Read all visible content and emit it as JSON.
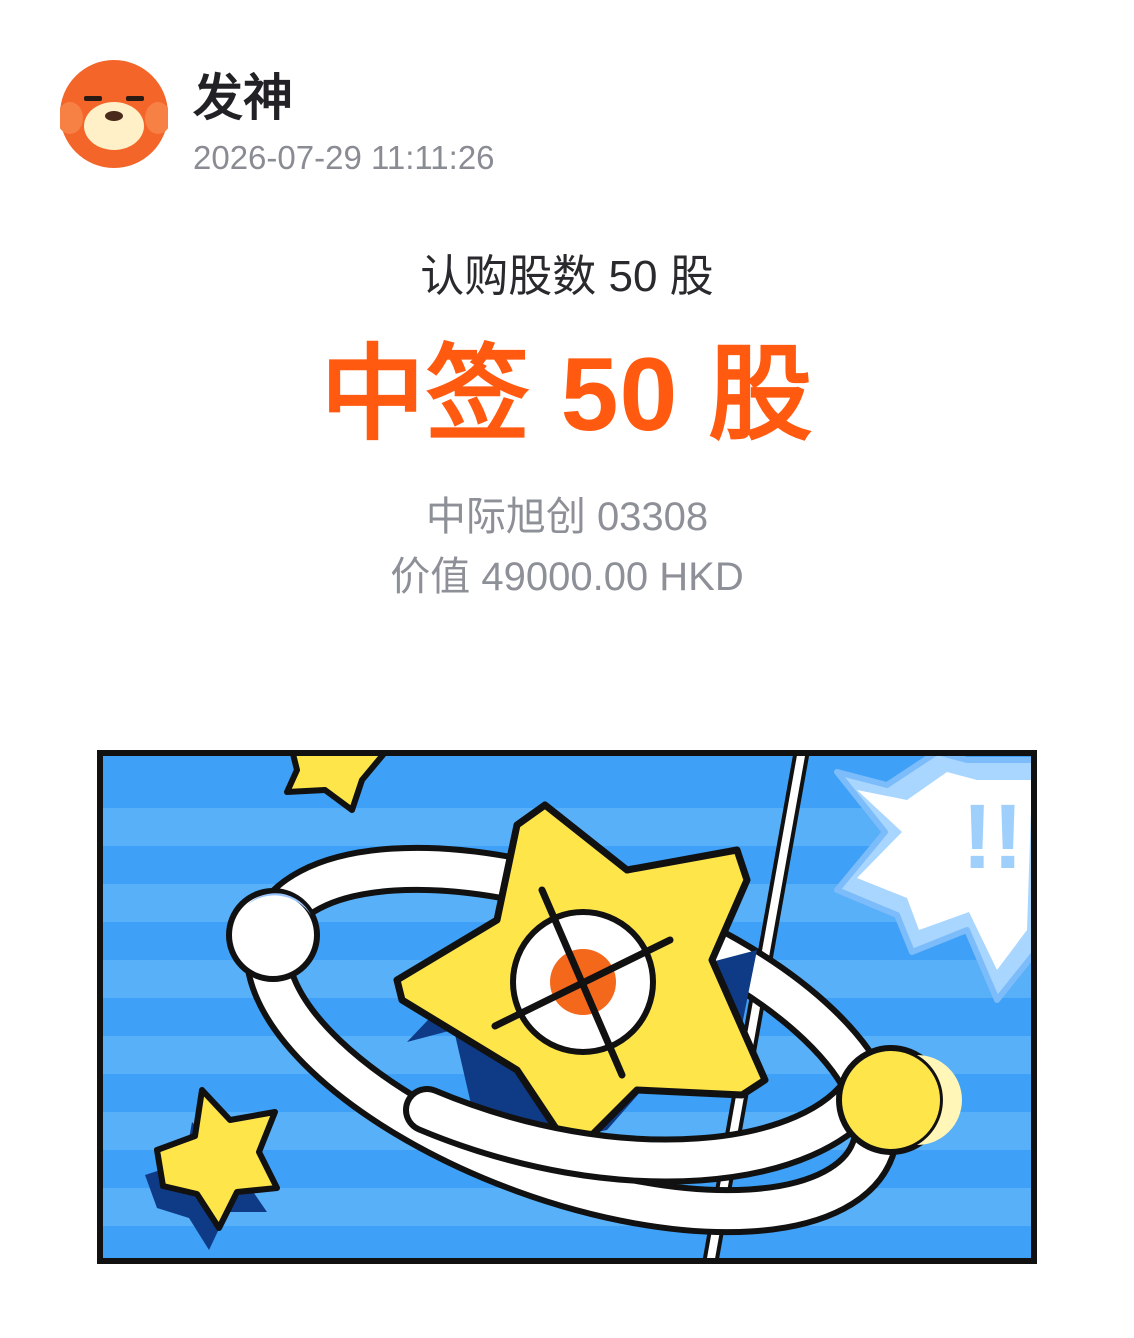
{
  "post": {
    "author": "发神",
    "timestamp": "2026-07-29 11:11:26",
    "avatar_icon": "cartoon-face-avatar",
    "avatar_color": "#f4652a"
  },
  "result": {
    "subscribed_text": "认购股数 50 股",
    "allotted_text": "中签 50 股",
    "stock_text": "中际旭创 03308",
    "value_text": "价值 49000.00 HKD",
    "accent_color": "#ff5a10"
  },
  "banner": {
    "icon": "star-planet-illustration",
    "exclaim_text": "!!",
    "background_color": "#3fa2f6"
  }
}
